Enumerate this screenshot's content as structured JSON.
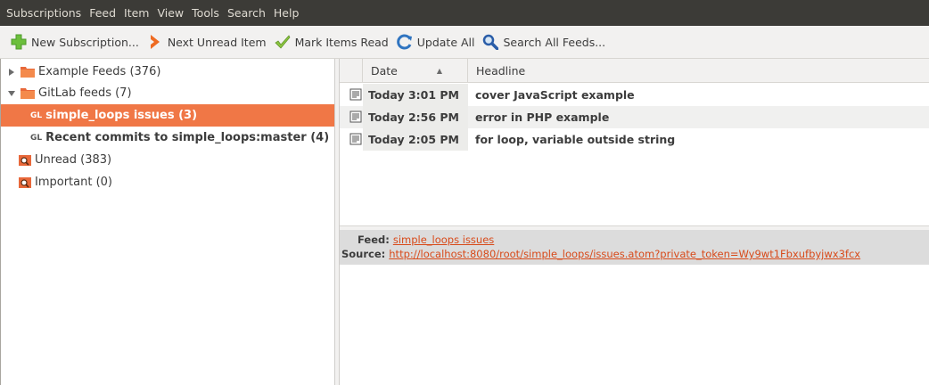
{
  "menubar": {
    "items": [
      "Subscriptions",
      "Feed",
      "Item",
      "View",
      "Tools",
      "Search",
      "Help"
    ]
  },
  "toolbar": {
    "new_subscription": "New Subscription...",
    "next_unread": "Next Unread Item",
    "mark_read": "Mark Items Read",
    "update_all": "Update All",
    "search_all": "Search All Feeds..."
  },
  "tree": {
    "example_feeds": "Example Feeds (376)",
    "gitlab_feeds": "GitLab feeds (7)",
    "gl_prefix": "GL",
    "simple_loops_issues": "simple_loops issues (3)",
    "recent_commits": "Recent commits to simple_loops:master (4)",
    "unread": "Unread (383)",
    "important": "Important (0)"
  },
  "list": {
    "columns": {
      "date": "Date",
      "headline": "Headline"
    },
    "items": [
      {
        "date": "Today 3:01 PM",
        "headline": "cover JavaScript example"
      },
      {
        "date": "Today 2:56 PM",
        "headline": "error in PHP example"
      },
      {
        "date": "Today 2:05 PM",
        "headline": "for loop, variable outside string"
      }
    ]
  },
  "preview": {
    "feed_label": "Feed:",
    "feed_value": "simple_loops issues",
    "source_label": "Source:",
    "source_value": "http://localhost:8080/root/simple_loops/issues.atom?private_token=Wy9wt1Fbxufbyjwx3fcx"
  },
  "colors": {
    "selection": "#f07746",
    "menubar": "#3c3b37",
    "link": "#d84a1a"
  }
}
